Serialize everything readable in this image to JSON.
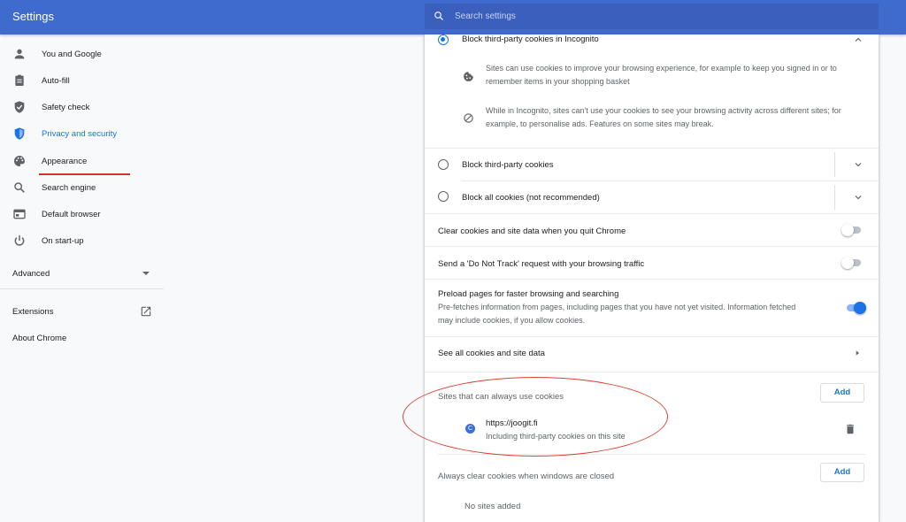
{
  "header": {
    "title": "Settings",
    "search_placeholder": "Search settings"
  },
  "sidebar": {
    "items": [
      {
        "label": "You and Google",
        "icon": "person-icon"
      },
      {
        "label": "Auto-fill",
        "icon": "clipboard-icon"
      },
      {
        "label": "Safety check",
        "icon": "shield-check-icon"
      },
      {
        "label": "Privacy and security",
        "icon": "shield-icon",
        "active": true
      },
      {
        "label": "Appearance",
        "icon": "palette-icon"
      },
      {
        "label": "Search engine",
        "icon": "search-icon"
      },
      {
        "label": "Default browser",
        "icon": "browser-icon"
      },
      {
        "label": "On start-up",
        "icon": "power-icon"
      }
    ],
    "advanced_label": "Advanced",
    "extensions_label": "Extensions",
    "about_label": "About Chrome"
  },
  "cookies": {
    "incognito_option": "Block third-party cookies in Incognito",
    "incognito_detail_1": "Sites can use cookies to improve your browsing experience, for example to keep you signed in or to remember items in your shopping basket",
    "incognito_detail_2": "While in Incognito, sites can't use your cookies to see your browsing activity across different sites; for example, to personalise ads. Features on some sites may break.",
    "block_third_party": "Block third-party cookies",
    "block_all": "Block all cookies (not recommended)",
    "clear_on_quit": "Clear cookies and site data when you quit Chrome",
    "do_not_track": "Send a 'Do Not Track' request with your browsing traffic",
    "preload_title": "Preload pages for faster browsing and searching",
    "preload_desc": "Pre-fetches information from pages, including pages that you have not yet visited. Information fetched may include cookies, if you allow cookies.",
    "see_all": "See all cookies and site data",
    "always_use_title": "Sites that can always use cookies",
    "add_label": "Add",
    "site_url": "https://joogit.fi",
    "site_desc": "Including third-party cookies on this site",
    "site_favicon_letter": "C",
    "always_clear_title": "Always clear cookies when windows are closed",
    "no_sites": "No sites added"
  },
  "toggles": {
    "clear_on_quit": false,
    "do_not_track": false,
    "preload": true
  },
  "colors": {
    "header": "#3f6bcf",
    "accent": "#1a73e8",
    "annotation": "#d9432f"
  }
}
